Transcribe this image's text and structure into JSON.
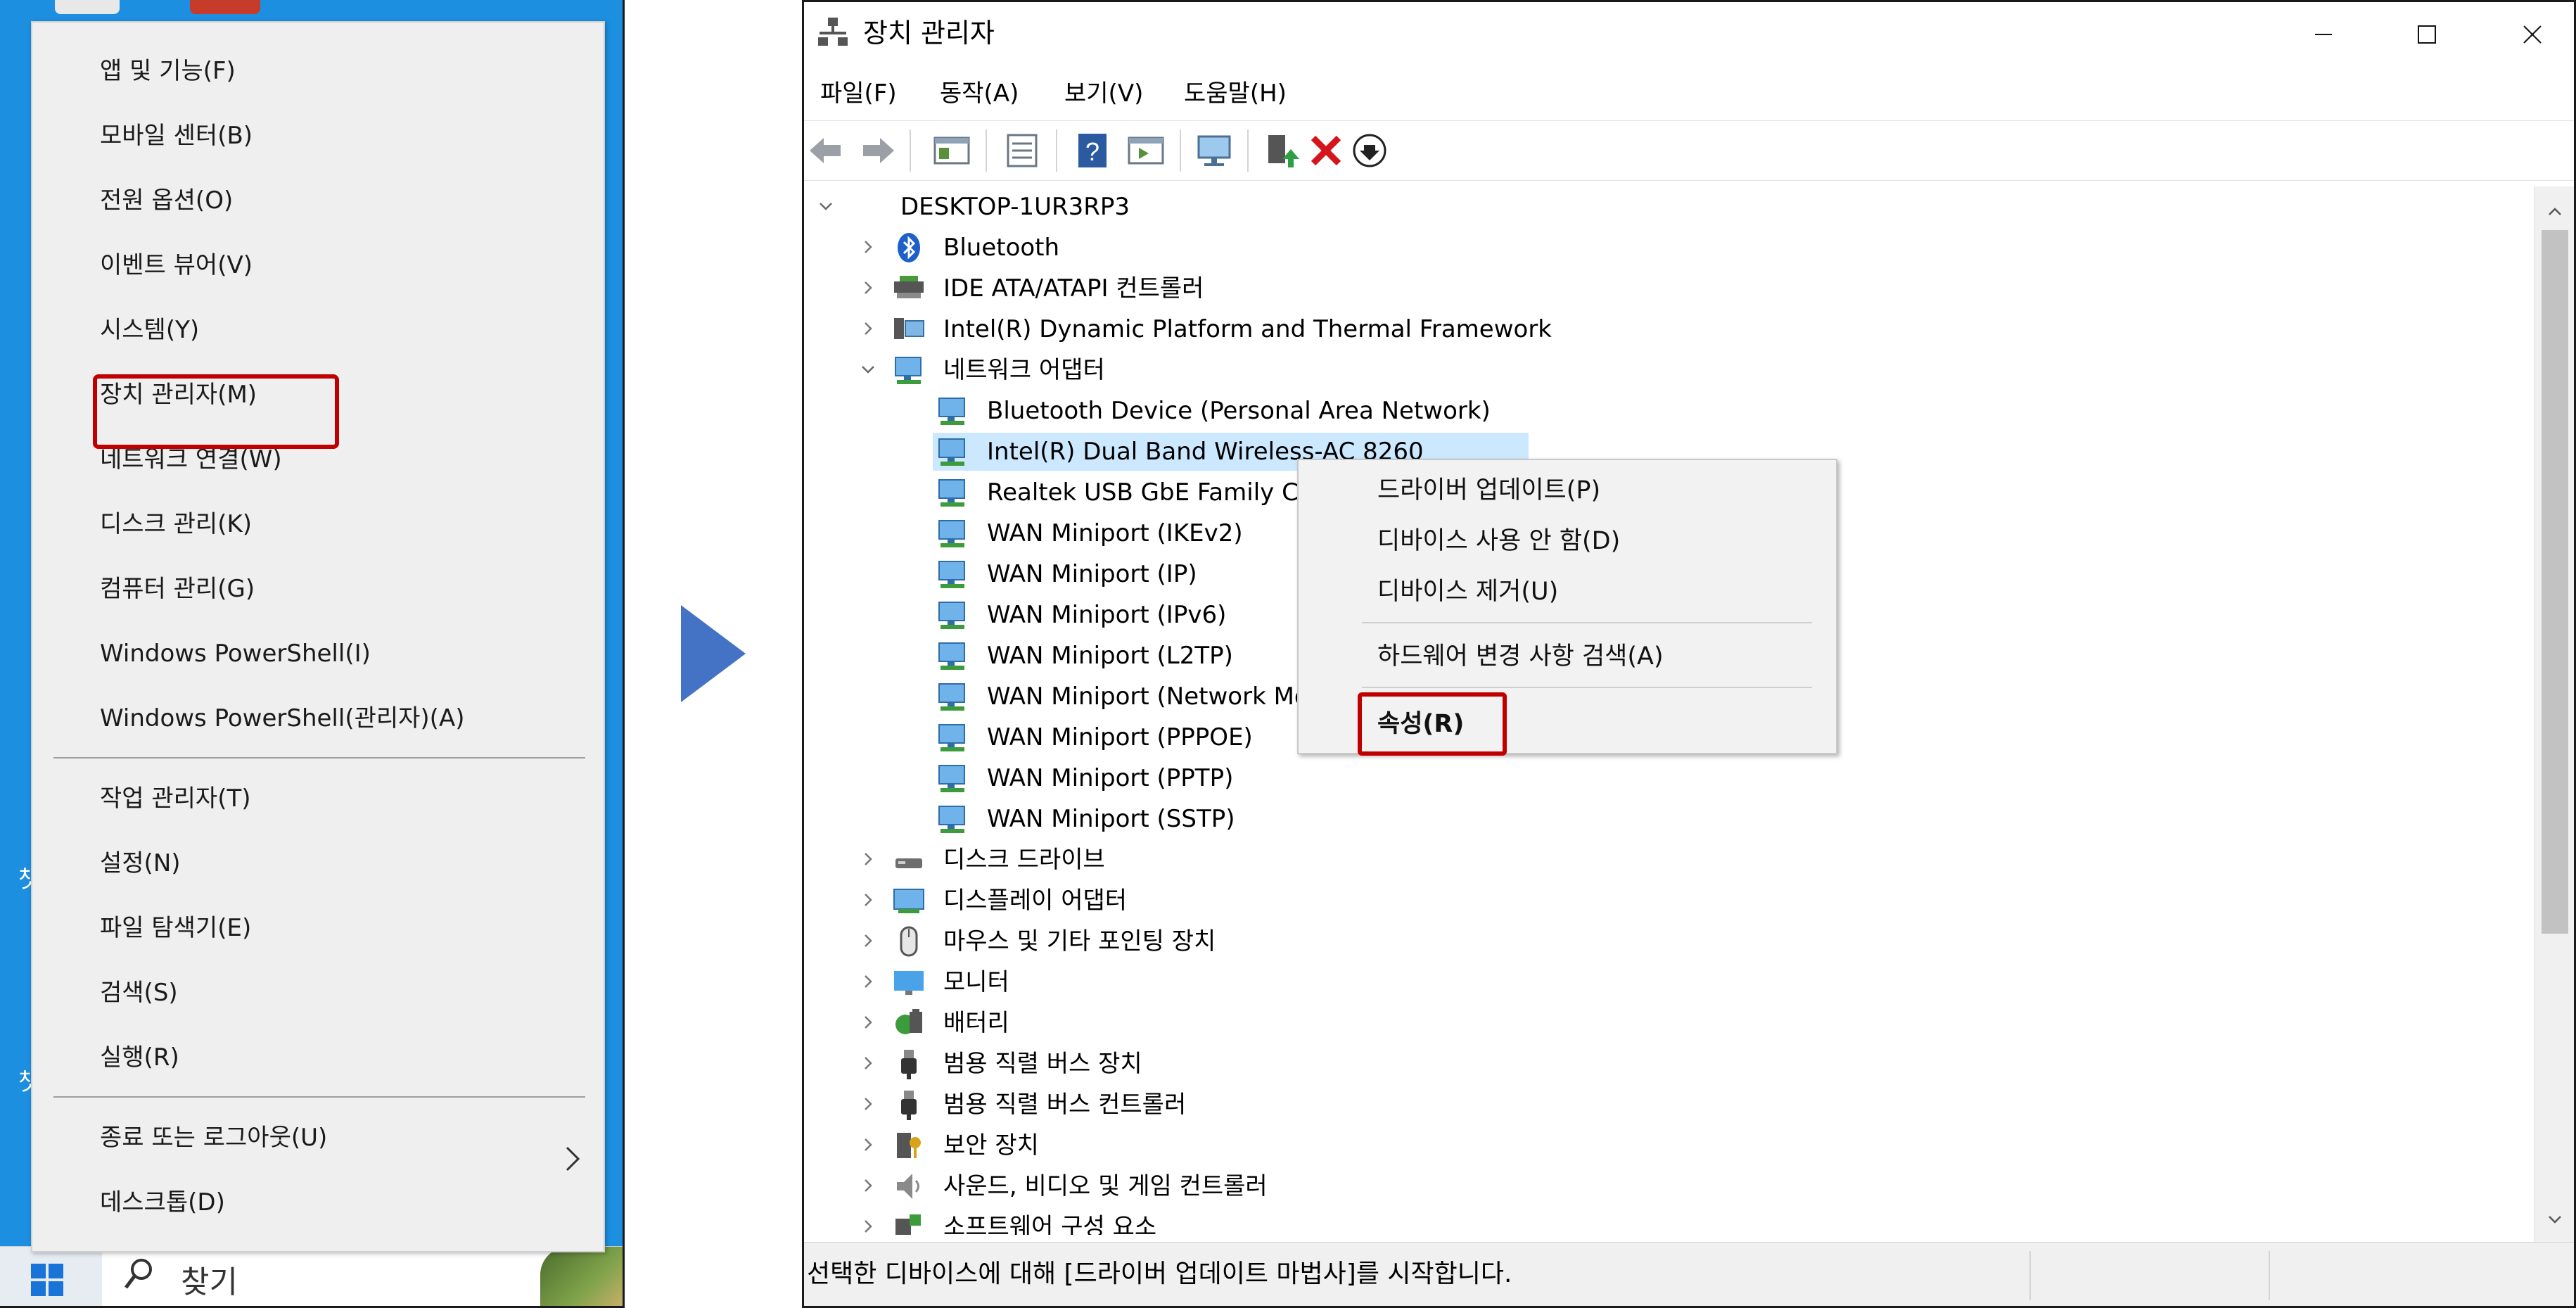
{
  "winx_menu": {
    "items": [
      {
        "label": "앱 및 기능(F)"
      },
      {
        "label": "모바일 센터(B)"
      },
      {
        "label": "전원 옵션(O)"
      },
      {
        "label": "이벤트 뷰어(V)"
      },
      {
        "label": "시스템(Y)"
      },
      {
        "label": "장치 관리자(M)"
      },
      {
        "label": "네트워크 연결(W)"
      },
      {
        "label": "디스크 관리(K)"
      },
      {
        "label": "컴퓨터 관리(G)"
      },
      {
        "label": "Windows PowerShell(I)"
      },
      {
        "label": "Windows PowerShell(관리자)(A)"
      },
      {
        "label": "작업 관리자(T)"
      },
      {
        "label": "설정(N)"
      },
      {
        "label": "파일 탐색기(E)"
      },
      {
        "label": "검색(S)"
      },
      {
        "label": "실행(R)"
      },
      {
        "label": "종료 또는 로그아웃(U)"
      },
      {
        "label": "데스크톱(D)"
      }
    ],
    "highlighted_item": "장치 관리자(M)"
  },
  "taskbar": {
    "search_text": "찾기",
    "desktop_icon_chars": [
      "챗",
      "챗"
    ]
  },
  "device_manager": {
    "title": "장치 관리자",
    "menu": {
      "file": "파일(F)",
      "action": "동작(A)",
      "view": "보기(V)",
      "help": "도움말(H)"
    },
    "toolbar_icons": [
      "back-icon",
      "forward-icon",
      "show-hide-tree-icon",
      "properties-icon",
      "help-icon",
      "action-pane-icon",
      "scan-hardware-icon",
      "update-driver-icon",
      "uninstall-device-icon",
      "disable-device-icon"
    ],
    "tree": {
      "root": "DESKTOP-1UR3RP3",
      "items": [
        {
          "label": "Bluetooth",
          "icon": "bluetooth-icon"
        },
        {
          "label": "IDE ATA/ATAPI 컨트롤러",
          "icon": "ide-controller-icon"
        },
        {
          "label": "Intel(R) Dynamic Platform and Thermal Framework",
          "icon": "framework-icon"
        },
        {
          "label": "네트워크 어댑터",
          "icon": "network-adapter-icon",
          "expanded": true,
          "children": [
            {
              "label": "Bluetooth Device (Personal Area Network)"
            },
            {
              "label": "Intel(R) Dual Band Wireless-AC 8260",
              "selected": true
            },
            {
              "label": "Realtek USB GbE Family Controller"
            },
            {
              "label": "WAN Miniport (IKEv2)"
            },
            {
              "label": "WAN Miniport (IP)"
            },
            {
              "label": "WAN Miniport (IPv6)"
            },
            {
              "label": "WAN Miniport (L2TP)"
            },
            {
              "label": "WAN Miniport (Network Monitor)"
            },
            {
              "label": "WAN Miniport (PPPOE)"
            },
            {
              "label": "WAN Miniport (PPTP)"
            },
            {
              "label": "WAN Miniport (SSTP)"
            }
          ]
        },
        {
          "label": "디스크 드라이브",
          "icon": "disk-drive-icon"
        },
        {
          "label": "디스플레이 어댑터",
          "icon": "display-adapter-icon"
        },
        {
          "label": "마우스 및 기타 포인팅 장치",
          "icon": "mouse-icon"
        },
        {
          "label": "모니터",
          "icon": "monitor-icon"
        },
        {
          "label": "배터리",
          "icon": "battery-icon"
        },
        {
          "label": "범용 직렬 버스 장치",
          "icon": "usb-device-icon"
        },
        {
          "label": "범용 직렬 버스 컨트롤러",
          "icon": "usb-controller-icon"
        },
        {
          "label": "보안 장치",
          "icon": "security-device-icon"
        },
        {
          "label": "사운드, 비디오 및 게임 컨트롤러",
          "icon": "sound-icon"
        },
        {
          "label": "소프트웨어 구성 요소",
          "icon": "software-component-icon"
        }
      ]
    },
    "context_menu": {
      "items": [
        {
          "label": "드라이버 업데이트(P)"
        },
        {
          "label": "디바이스 사용 안 함(D)"
        },
        {
          "label": "디바이스 제거(U)"
        },
        {
          "label": "하드웨어 변경 사항 검색(A)"
        },
        {
          "label": "속성(R)"
        }
      ],
      "highlighted_item": "속성(R)"
    },
    "status_text": "선택한 디바이스에 대해 [드라이버 업데이트 마법사]를 시작합니다."
  },
  "colors": {
    "accent_red": "#c00000",
    "arrow_blue": "#4472c4",
    "selection": "#cce8ff",
    "desktop_blue": "#1c8fe0"
  }
}
